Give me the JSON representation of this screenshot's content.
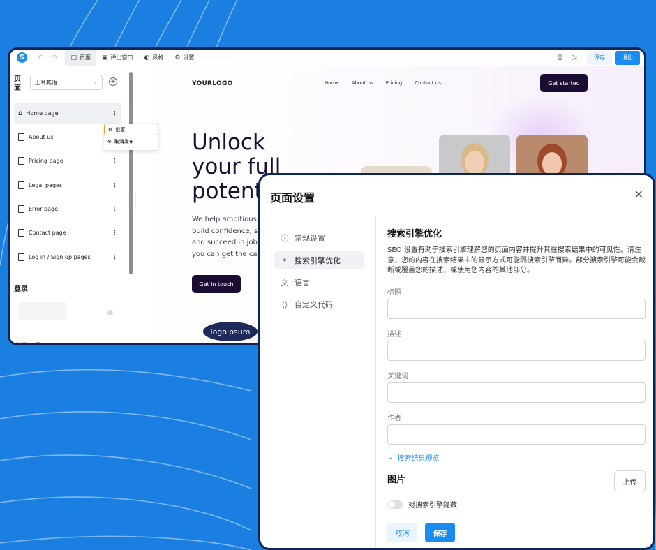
{
  "colors": {
    "background": "#1a7fe0",
    "accent": "#1a8cf0",
    "dark_button": "#1a0c33",
    "frame": "#0e2656"
  },
  "toolbar": {
    "logo": "S",
    "undo_icon": "undo-icon",
    "redo_icon": "redo-icon",
    "items": [
      {
        "label": "页面",
        "icon": "page-icon"
      },
      {
        "label": "弹出窗口",
        "icon": "popup-icon"
      },
      {
        "label": "风格",
        "icon": "palette-icon"
      },
      {
        "label": "设置",
        "icon": "gear-icon"
      }
    ],
    "save_label": "保存",
    "exit_label": "退出"
  },
  "sidebar": {
    "title": "页面",
    "language": "土耳其语",
    "pages": [
      {
        "label": "Home page"
      },
      {
        "label": "About us"
      },
      {
        "label": "Pricing page"
      },
      {
        "label": "Legal pages"
      },
      {
        "label": "Error page"
      },
      {
        "label": "Contact page"
      },
      {
        "label": "Log in / Sign up pages"
      }
    ],
    "login_section": "登录",
    "tools_section": "实用工具"
  },
  "context_menu": {
    "settings": "设置",
    "unpublish": "取消发布"
  },
  "preview": {
    "logo": "YOURLOGO",
    "nav": [
      "Home",
      "About us",
      "Pricing",
      "Contact us"
    ],
    "cta": "Get started",
    "hero_title_lines": [
      "Unlock",
      "your full",
      "potent"
    ],
    "hero_text_lines": [
      "We help ambitious p",
      "build confidence, sh",
      "and succeed in job i",
      "you can get the care"
    ],
    "hero_button": "Get in touch",
    "partner_logo": "logoipsum"
  },
  "modal": {
    "title": "页面设置",
    "close_icon": "close-icon",
    "nav": [
      {
        "label": "常规设置",
        "icon": "info-icon"
      },
      {
        "label": "搜索引擎优化",
        "icon": "seo-icon"
      },
      {
        "label": "语言",
        "icon": "translate-icon"
      },
      {
        "label": "自定义代码",
        "icon": "code-icon"
      }
    ],
    "section_title": "搜索引擎优化",
    "description": "SEO 设置有助于搜索引擎理解您的页面内容并提升其在搜索结果中的可见性。请注意，您的内容在搜索结果中的显示方式可能因搜索引擎而异。部分搜索引擎可能会截断或覆盖您的描述，或使用您内容的其他部分。",
    "fields": [
      {
        "label": "标题",
        "value": ""
      },
      {
        "label": "描述",
        "value": ""
      },
      {
        "label": "关键词",
        "value": ""
      },
      {
        "label": "作者",
        "value": ""
      }
    ],
    "preview_toggle": "搜索结果预览",
    "image_title": "图片",
    "upload": "上传",
    "hide_toggle": "对搜索引擎隐藏",
    "hide_toggle_on": false,
    "cancel": "取消",
    "save": "保存"
  }
}
